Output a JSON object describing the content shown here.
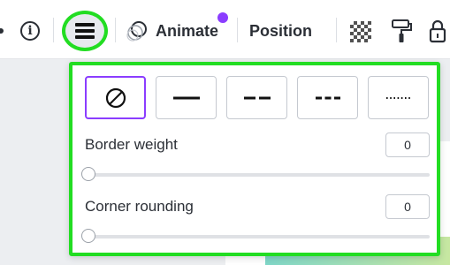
{
  "toolbar": {
    "info_icon": "info-icon",
    "border_style_icon": "border-style-icon",
    "animate_label": "Animate",
    "animate_badge_color": "#8b3dff",
    "position_label": "Position",
    "transparency_icon": "transparency-icon",
    "paint_roller_icon": "paint-roller-icon",
    "lock_icon": "lock-icon"
  },
  "border_panel": {
    "highlight_color": "#22dd22",
    "selected_color": "#8b3dff",
    "style_options": [
      {
        "name": "none",
        "selected": true
      },
      {
        "name": "solid",
        "selected": false
      },
      {
        "name": "dashed",
        "selected": false
      },
      {
        "name": "short-dashed",
        "selected": false
      },
      {
        "name": "dotted",
        "selected": false
      }
    ],
    "border_weight": {
      "label": "Border weight",
      "value": "0",
      "slider_fraction": 0
    },
    "corner_rounding": {
      "label": "Corner rounding",
      "value": "0",
      "slider_fraction": 0
    }
  }
}
